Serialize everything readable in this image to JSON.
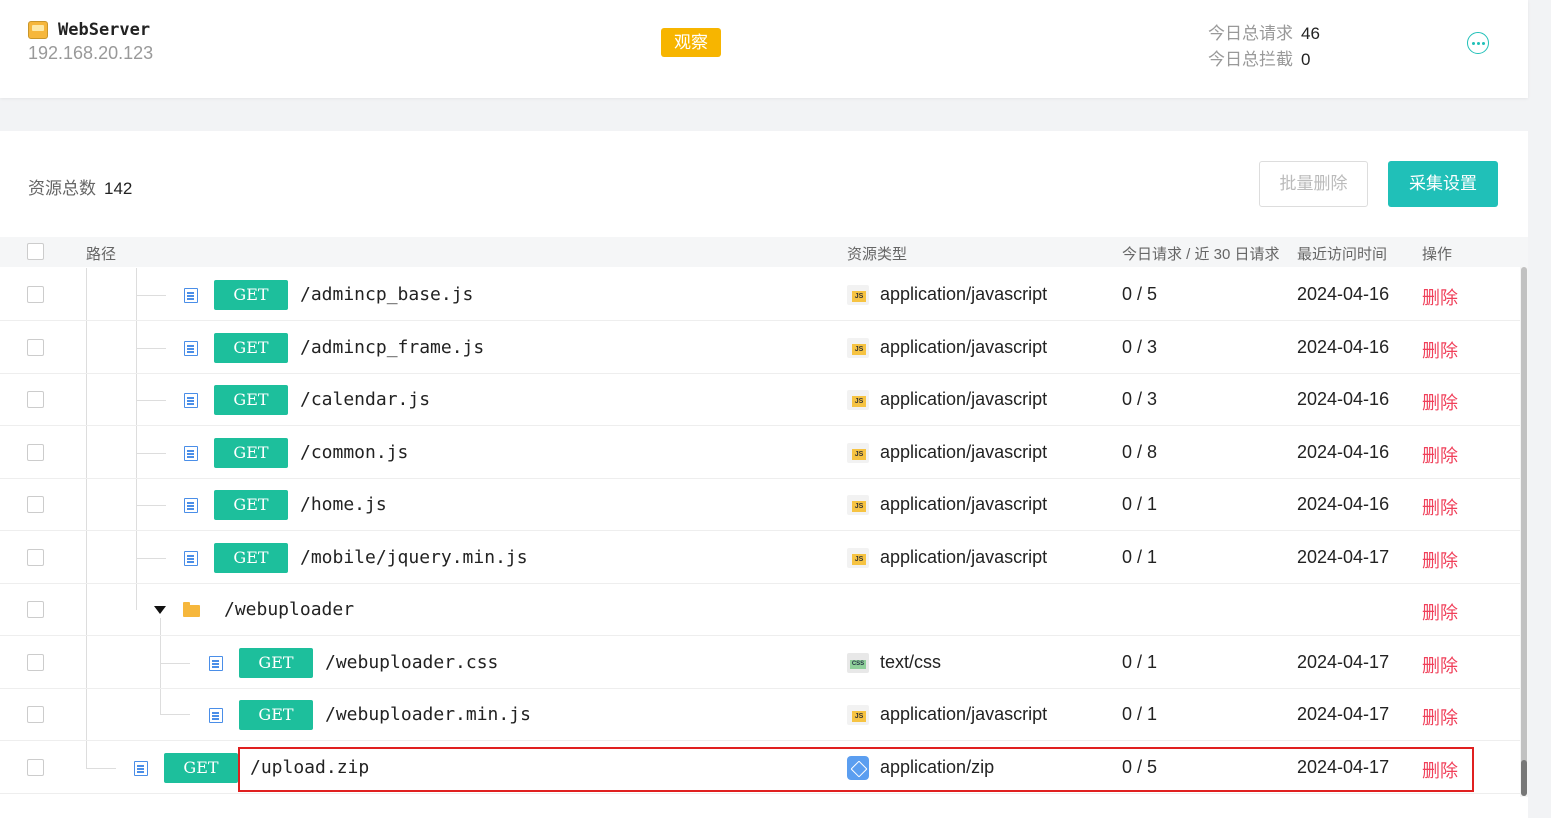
{
  "server": {
    "name": "WebServer",
    "ip": "192.168.20.123",
    "mode": "观察",
    "today_requests_label": "今日总请求",
    "today_requests": "46",
    "today_blocked_label": "今日总拦截",
    "today_blocked": "0"
  },
  "resources": {
    "count_label": "资源总数",
    "count": "142",
    "batch_delete": "批量删除",
    "collect_settings": "采集设置"
  },
  "table": {
    "headers": {
      "path": "路径",
      "type": "资源类型",
      "requests": "今日请求 / 近 30 日请求",
      "last_visit": "最近访问时间",
      "action": "操作"
    },
    "rows": [
      {
        "method": "GET",
        "path": "/admincp_base.js",
        "type": "application/javascript",
        "type_icon": "js-file-icon",
        "requests": "0 / 5",
        "date": "2024-04-16",
        "action": "删除"
      },
      {
        "method": "GET",
        "path": "/admincp_frame.js",
        "type": "application/javascript",
        "type_icon": "js-file-icon",
        "requests": "0 / 3",
        "date": "2024-04-16",
        "action": "删除"
      },
      {
        "method": "GET",
        "path": "/calendar.js",
        "type": "application/javascript",
        "type_icon": "js-file-icon",
        "requests": "0 / 3",
        "date": "2024-04-16",
        "action": "删除"
      },
      {
        "method": "GET",
        "path": "/common.js",
        "type": "application/javascript",
        "type_icon": "js-file-icon",
        "requests": "0 / 8",
        "date": "2024-04-16",
        "action": "删除"
      },
      {
        "method": "GET",
        "path": "/home.js",
        "type": "application/javascript",
        "type_icon": "js-file-icon",
        "requests": "0 / 1",
        "date": "2024-04-16",
        "action": "删除"
      },
      {
        "method": "GET",
        "path": "/mobile/jquery.min.js",
        "type": "application/javascript",
        "type_icon": "js-file-icon",
        "requests": "0 / 1",
        "date": "2024-04-17",
        "action": "删除"
      },
      {
        "folder": true,
        "path": "/webuploader",
        "action": "删除"
      },
      {
        "method": "GET",
        "path": "/webuploader.css",
        "type": "text/css",
        "type_icon": "css-file-icon",
        "requests": "0 / 1",
        "date": "2024-04-17",
        "action": "删除"
      },
      {
        "method": "GET",
        "path": "/webuploader.min.js",
        "type": "application/javascript",
        "type_icon": "js-file-icon",
        "requests": "0 / 1",
        "date": "2024-04-17",
        "action": "删除"
      },
      {
        "method": "GET",
        "path": "/upload.zip",
        "type": "application/zip",
        "type_icon": "zip-file-icon",
        "requests": "0 / 5",
        "date": "2024-04-17",
        "action": "删除",
        "highlighted": true
      }
    ]
  },
  "colors": {
    "accent": "#20c0b8",
    "get_badge": "#1dbf9c",
    "mode_badge": "#f7b500",
    "delete_link": "#f0405a",
    "highlight_border": "#e02020"
  }
}
